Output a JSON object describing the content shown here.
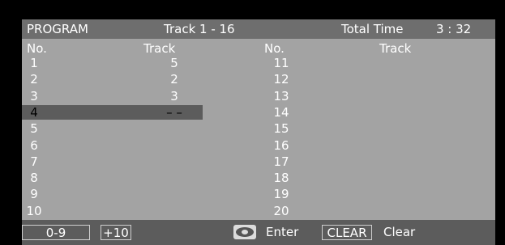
{
  "header": {
    "title": "PROGRAM",
    "track_range": "Track 1 - 16",
    "total_time_label": "Total Time",
    "total_time_value": "3 : 32"
  },
  "columns": {
    "no_label": "No.",
    "track_label": "Track"
  },
  "left_rows": [
    {
      "no": "1",
      "track": "5"
    },
    {
      "no": "2",
      "track": "2"
    },
    {
      "no": "3",
      "track": "3"
    },
    {
      "no": "4",
      "track": "– –"
    },
    {
      "no": "5",
      "track": ""
    },
    {
      "no": "6",
      "track": ""
    },
    {
      "no": "7",
      "track": ""
    },
    {
      "no": "8",
      "track": ""
    },
    {
      "no": "9",
      "track": ""
    },
    {
      "no": "10",
      "track": ""
    }
  ],
  "right_rows": [
    {
      "no": "11",
      "track": ""
    },
    {
      "no": "12",
      "track": ""
    },
    {
      "no": "13",
      "track": ""
    },
    {
      "no": "14",
      "track": ""
    },
    {
      "no": "15",
      "track": ""
    },
    {
      "no": "16",
      "track": ""
    },
    {
      "no": "17",
      "track": ""
    },
    {
      "no": "18",
      "track": ""
    },
    {
      "no": "19",
      "track": ""
    },
    {
      "no": "20",
      "track": ""
    }
  ],
  "footer": {
    "digits_button": "0-9",
    "plus10_button": "+10",
    "enter_label": "Enter",
    "clear_button": "CLEAR",
    "clear_label": "Clear",
    "enter_icon": "disc-select-icon"
  }
}
